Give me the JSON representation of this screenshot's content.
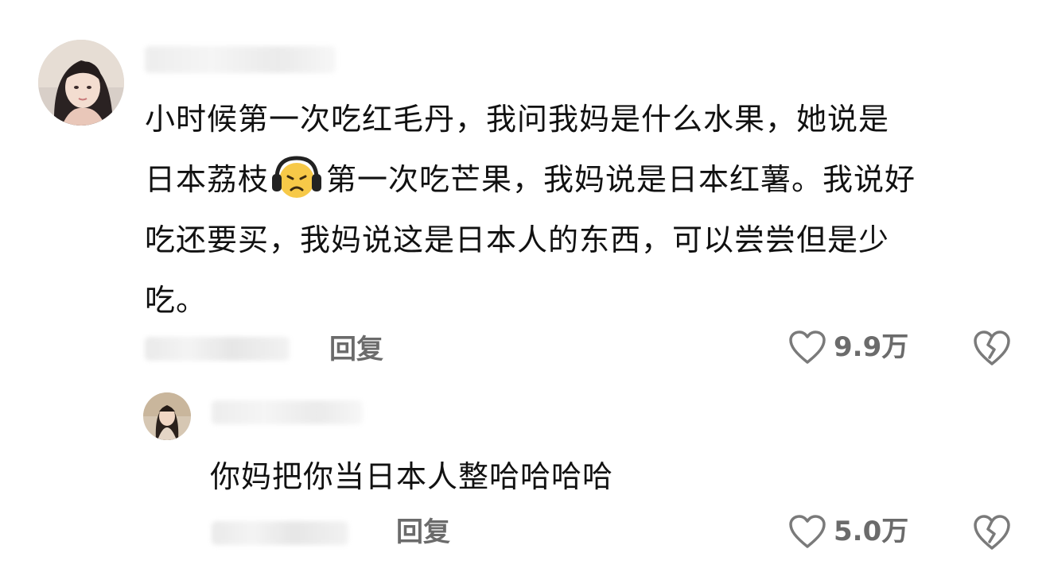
{
  "comments": [
    {
      "text_line1": "小时候第一次吃红毛丹，我问我妈是什么水果，她说是",
      "text_line2_before": "日本荔枝",
      "emoji": "headphones-face-emoji",
      "text_line2_after": "第一次吃芒果，我妈说是日本红薯。我说好",
      "text_line3": "吃还要买，我妈说这是日本人的东西，可以尝尝但是少",
      "text_line4": "吃。",
      "reply_label": "回复",
      "like_count": "9.9万"
    },
    {
      "text": "你妈把你当日本人整哈哈哈哈",
      "reply_label": "回复",
      "like_count": "5.0万"
    }
  ],
  "colors": {
    "text": "#111111",
    "meta": "#6b6b6b",
    "icon": "#7a7a7a"
  }
}
